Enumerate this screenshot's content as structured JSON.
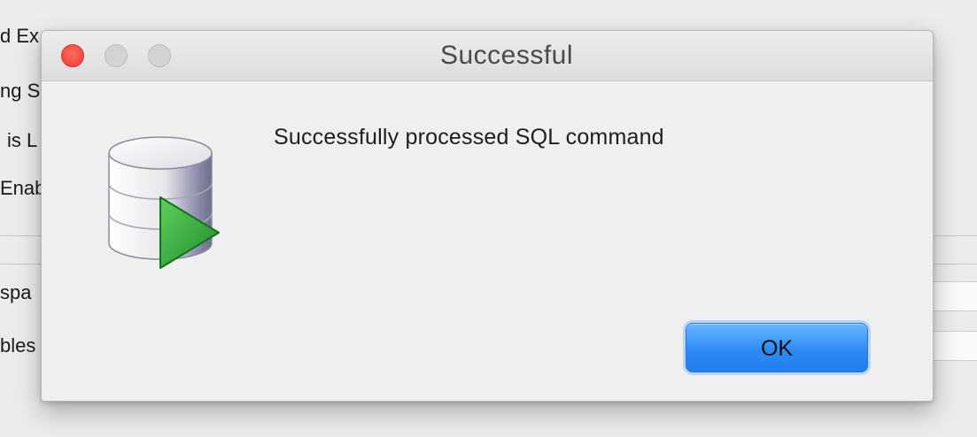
{
  "background_window": {
    "fragments": [
      "d Ex",
      "ng S",
      "is L",
      "Enab",
      "spa",
      "bles"
    ]
  },
  "dialog": {
    "title": "Successful",
    "message": "Successfully processed SQL command",
    "ok_label": "OK",
    "icon": "database-run-icon",
    "window_controls": [
      "close-icon",
      "minimize-icon",
      "zoom-icon"
    ]
  },
  "colors": {
    "close_button": "#ec3c32",
    "ok_button": "#2f8cf5",
    "play_arrow": "#2ea33a"
  }
}
